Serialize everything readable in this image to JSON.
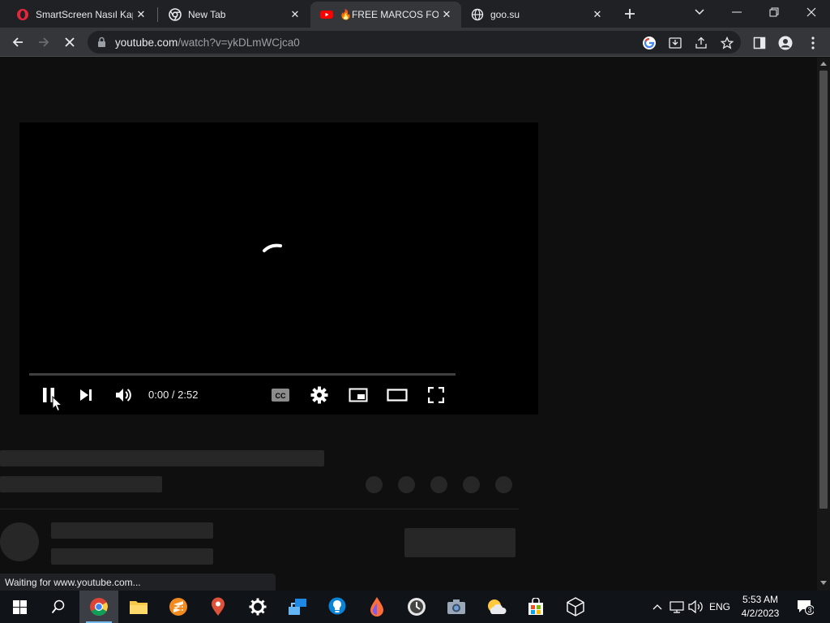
{
  "tabs": [
    {
      "title": "SmartScreen Nasıl Kap",
      "favicon": "opera-icon",
      "active": false
    },
    {
      "title": "New Tab",
      "favicon": "chrome-icon",
      "active": false
    },
    {
      "title": "🔥FREE MARCOS FOR",
      "favicon": "youtube-icon",
      "active": true
    },
    {
      "title": "goo.su",
      "favicon": "globe-icon",
      "active": false
    }
  ],
  "address_bar": {
    "url_host": "youtube.com",
    "url_path": "/watch?v=ykDLmWCjca0"
  },
  "player": {
    "time": "0:00 / 2:52",
    "state": "loading",
    "progress": 0
  },
  "status_text": "Waiting for www.youtube.com...",
  "taskbar": {
    "apps": [
      "chrome-icon",
      "file-explorer-icon",
      "sublime-icon",
      "maps-pin-icon",
      "settings-icon",
      "network-app-icon",
      "lightbulb-icon",
      "droplet-icon",
      "yandex-icon",
      "camera-icon",
      "weather-icon",
      "store-icon",
      "cube-icon"
    ],
    "language": "ENG",
    "time": "5:53 AM",
    "date": "4/2/2023",
    "notification_count": "3"
  },
  "colors": {
    "tab_strip": "#202124",
    "toolbar": "#35363a",
    "page_bg": "#0f0f0f",
    "skeleton": "#272727",
    "youtube_red": "#ff0000"
  }
}
